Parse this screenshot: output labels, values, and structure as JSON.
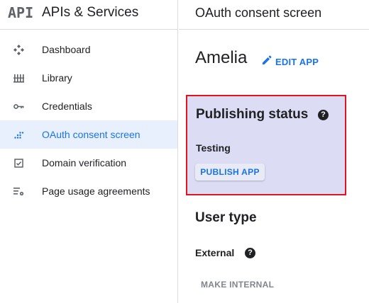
{
  "sidebar": {
    "logo_text": "API",
    "title": "APIs & Services",
    "items": [
      {
        "label": "Dashboard",
        "icon": "dashboard-icon",
        "active": false
      },
      {
        "label": "Library",
        "icon": "library-icon",
        "active": false
      },
      {
        "label": "Credentials",
        "icon": "key-icon",
        "active": false
      },
      {
        "label": "OAuth consent screen",
        "icon": "oauth-icon",
        "active": true
      },
      {
        "label": "Domain verification",
        "icon": "checkbox-icon",
        "active": false
      },
      {
        "label": "Page usage agreements",
        "icon": "settings-list-icon",
        "active": false
      }
    ]
  },
  "main": {
    "page_title": "OAuth consent screen",
    "app_name": "Amelia",
    "edit_app_label": "EDIT APP",
    "publishing": {
      "title": "Publishing status",
      "help_glyph": "?",
      "status": "Testing",
      "publish_button": "PUBLISH APP"
    },
    "user_type": {
      "title": "User type",
      "value": "External",
      "help_glyph": "?",
      "make_internal": "MAKE INTERNAL"
    }
  },
  "colors": {
    "accent": "#1a73e8",
    "highlight_border": "#e0141e",
    "highlight_fill": "#dcdcf4",
    "active_nav_bg": "#e8f0fe"
  }
}
